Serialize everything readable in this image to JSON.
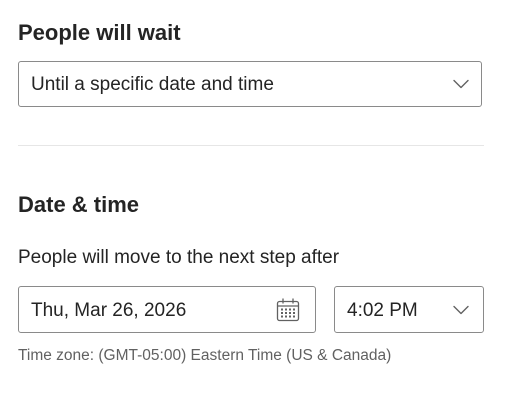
{
  "wait": {
    "heading": "People will wait",
    "selected_option": "Until a specific date and time",
    "chevron_icon": "chevron-down-icon"
  },
  "datetime": {
    "heading": "Date & time",
    "label": "People will move to the next step after",
    "date_value": "Thu, Mar 26, 2026",
    "calendar_icon": "calendar-icon",
    "time_value": "4:02 PM",
    "time_chevron_icon": "chevron-down-icon",
    "timezone_note": "Time zone: (GMT-05:00) Eastern Time (US & Canada)"
  },
  "colors": {
    "text": "#242424",
    "secondary_text": "#616161",
    "border": "#8a8a8a",
    "divider": "#e6e6e6",
    "background": "#ffffff"
  }
}
